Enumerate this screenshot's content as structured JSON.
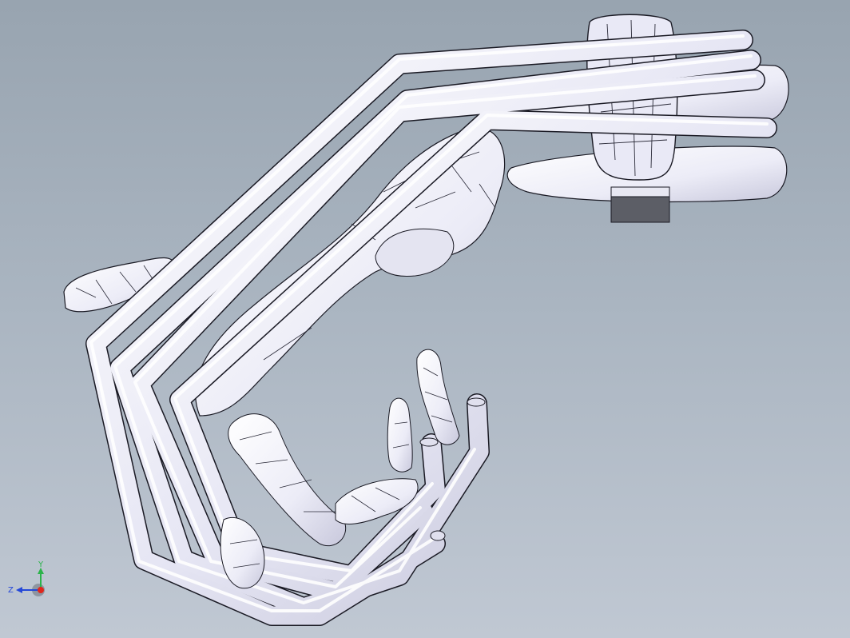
{
  "triad": {
    "x_axis": "",
    "y_axis": "Y",
    "z_axis": "Z"
  },
  "colors": {
    "background_top": "#98a4b0",
    "background_bottom": "#c0c8d3",
    "part_fill": "#eeeef9",
    "part_edge": "#1a1a24",
    "triad_x": "#e0261c",
    "triad_y": "#2bb34a",
    "triad_z": "#2448d8"
  },
  "model": {
    "description_icon": "cad-hand-with-tubes"
  }
}
